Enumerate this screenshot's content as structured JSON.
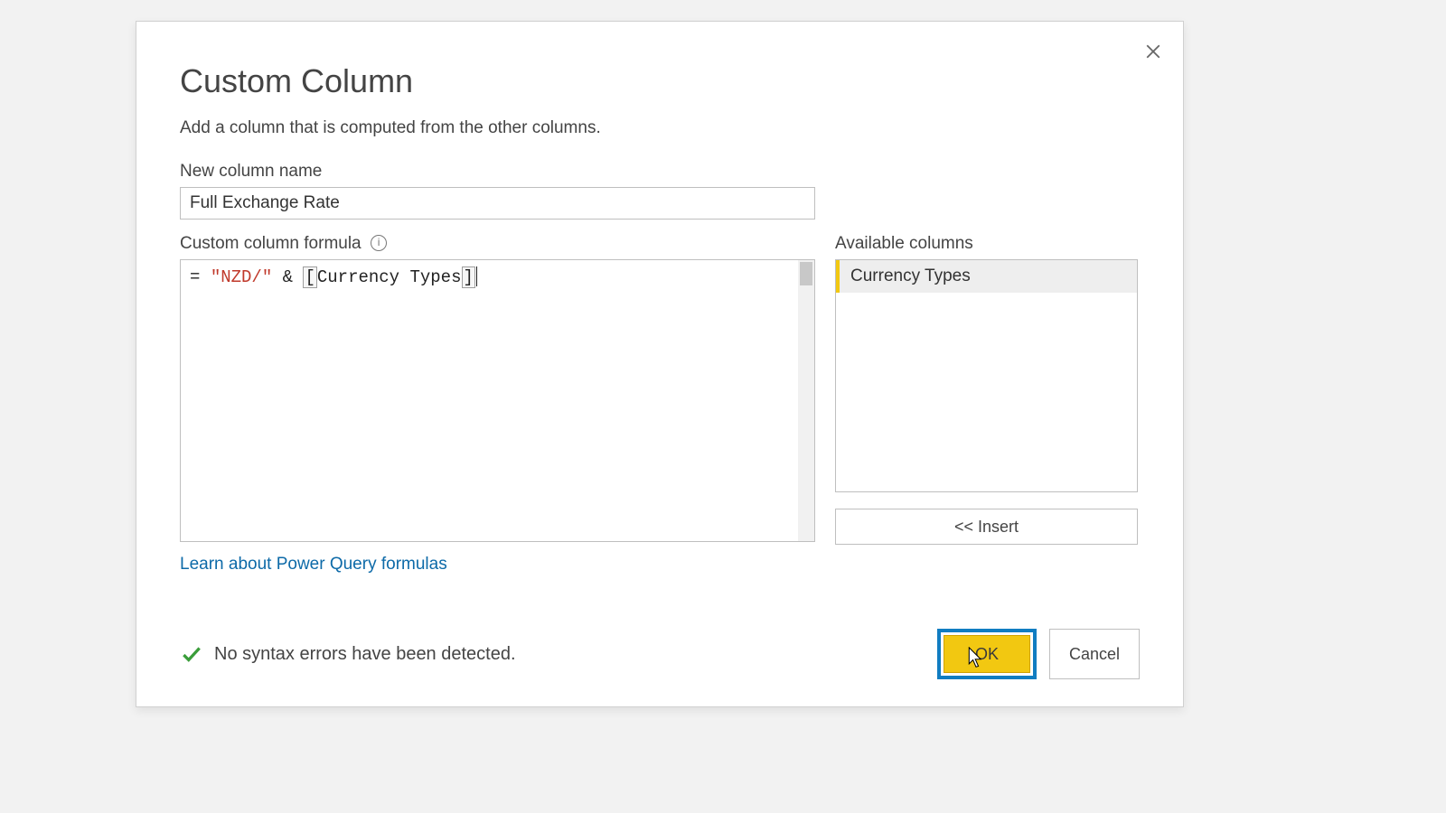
{
  "dialog": {
    "title": "Custom Column",
    "subtitle": "Add a column that is computed from the other columns.",
    "newColumnLabel": "New column name",
    "newColumnValue": "Full Exchange Rate",
    "formulaLabel": "Custom column formula",
    "formula": {
      "raw": "= \"NZD/\" & [Currency Types]",
      "tok_eq": "=",
      "tok_str": "\"NZD/\"",
      "tok_op": "&",
      "tok_lbr": "[",
      "tok_col": "Currency Types",
      "tok_rbr": "]"
    },
    "availableLabel": "Available columns",
    "availableColumns": [
      "Currency Types"
    ],
    "insertLabel": "<< Insert",
    "linkLabel": "Learn about Power Query formulas",
    "status": "No syntax errors have been detected.",
    "okLabel": "OK",
    "cancelLabel": "Cancel"
  }
}
